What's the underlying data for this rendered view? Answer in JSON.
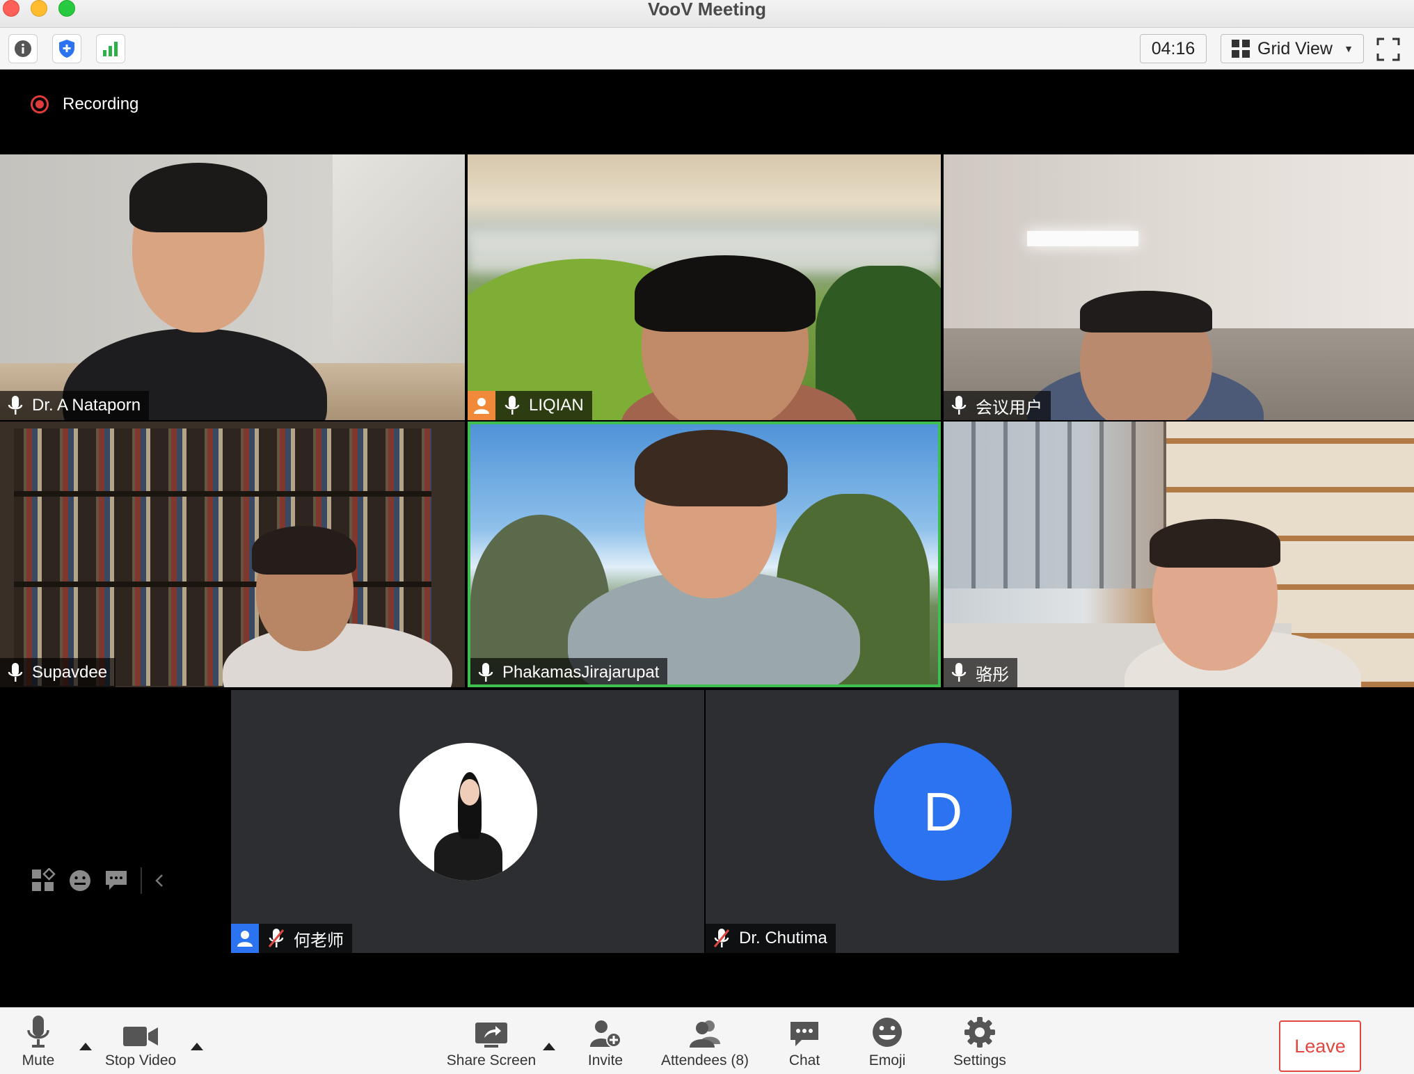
{
  "window": {
    "title": "VooV Meeting"
  },
  "toolbar": {
    "timer": "04:16",
    "view_mode": "Grid View"
  },
  "recording": {
    "label": "Recording"
  },
  "participants": [
    {
      "name": "Dr. A Nataporn",
      "mic": "on"
    },
    {
      "name": "LIQIAN",
      "mic": "on",
      "host": true
    },
    {
      "name": "会议用户",
      "mic": "on"
    },
    {
      "name": "Supavdee",
      "mic": "on"
    },
    {
      "name": "PhakamasJirajarupat",
      "mic": "on",
      "active_speaker": true
    },
    {
      "name": "骆彤",
      "mic": "on"
    },
    {
      "name": "何老师",
      "mic": "muted",
      "host": true
    },
    {
      "name": "Dr. Chutima",
      "mic": "muted",
      "avatar_letter": "D"
    }
  ],
  "bottombar": {
    "mute": "Mute",
    "stop_video": "Stop Video",
    "share_screen": "Share Screen",
    "invite": "Invite",
    "attendees": "Attendees (8)",
    "chat": "Chat",
    "emoji": "Emoji",
    "settings": "Settings",
    "leave": "Leave"
  },
  "colors": {
    "active_speaker_border": "#3fbf4f",
    "leave": "#e0483f",
    "avatar_blue": "#2b73f0",
    "host_badge": "#f08a3a",
    "cohost_badge": "#2b73f0"
  }
}
